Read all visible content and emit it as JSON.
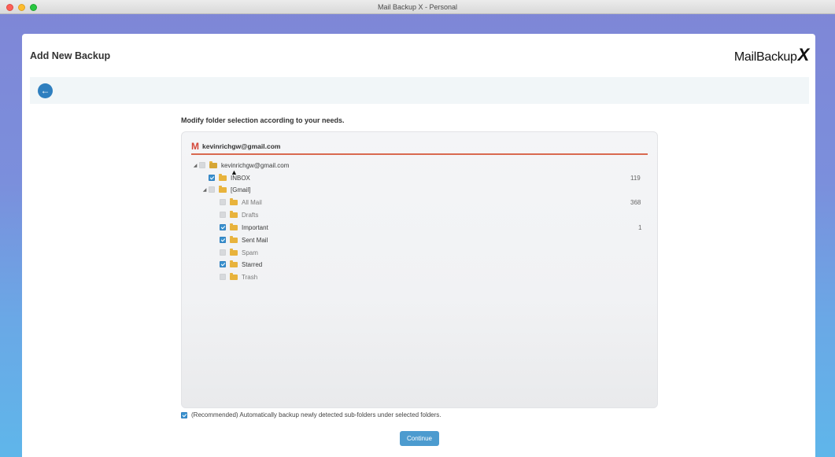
{
  "window": {
    "title": "Mail Backup X - Personal"
  },
  "header": {
    "title": "Add New Backup",
    "logo_text": "MailBackup",
    "logo_mark": "X"
  },
  "instruction": "Modify folder selection according to your needs.",
  "account": {
    "email": "kevinrichgw@gmail.com"
  },
  "tree": {
    "root": {
      "label": "kevinrichgw@gmail.com",
      "checked": false,
      "expanded": true
    },
    "inbox": {
      "label": "INBOX",
      "checked": true,
      "count": "119"
    },
    "gmail": {
      "label": "[Gmail]",
      "checked": false,
      "expanded": true
    },
    "children": [
      {
        "label": "All Mail",
        "checked": false,
        "count": "368"
      },
      {
        "label": "Drafts",
        "checked": false,
        "count": ""
      },
      {
        "label": "Important",
        "checked": true,
        "count": "1"
      },
      {
        "label": "Sent Mail",
        "checked": true,
        "count": ""
      },
      {
        "label": "Spam",
        "checked": false,
        "count": ""
      },
      {
        "label": "Starred",
        "checked": true,
        "count": ""
      },
      {
        "label": "Trash",
        "checked": false,
        "count": ""
      }
    ]
  },
  "recommend": {
    "label": "(Recommended) Automatically backup newly detected sub-folders under selected folders.",
    "checked": true
  },
  "continue_label": "Continue",
  "colors": {
    "accent": "#3a92cf",
    "folder": "#e8b33c",
    "gmail": "#d44638"
  }
}
